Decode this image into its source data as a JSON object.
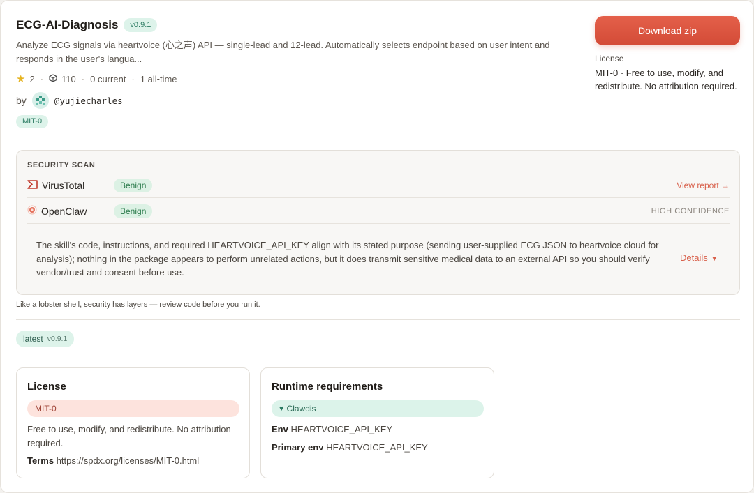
{
  "skill": {
    "title": "ECG-AI-Diagnosis",
    "version": "v0.9.1",
    "description": "Analyze ECG signals via heartvoice (心之声) API — single-lead and 12-lead. Automatically selects endpoint based on user intent and responds in the user's langua...",
    "stars": "2",
    "downloads": "110",
    "current_installs": "0 current",
    "alltime_installs": "1 all-time",
    "by_label": "by",
    "author": "@yujiecharles",
    "license_tag": "MIT-0"
  },
  "sidebar": {
    "download_label": "Download zip",
    "license_label": "License",
    "license_text": "MIT-0 · Free to use, modify, and redistribute. No attribution required."
  },
  "security": {
    "title": "SECURITY SCAN",
    "virustotal": {
      "name": "VirusTotal",
      "status": "Benign",
      "action": "View report →"
    },
    "openclaw": {
      "name": "OpenClaw",
      "status": "Benign",
      "confidence": "HIGH CONFIDENCE"
    },
    "summary": "The skill's code, instructions, and required HEARTVOICE_API_KEY align with its stated purpose (sending user-supplied ECG JSON to heartvoice cloud for analysis); nothing in the package appears to perform unrelated actions, but it does transmit sensitive medical data to an external API so you should verify vendor/trust and consent before use.",
    "details_label": "Details",
    "footnote": "Like a lobster shell, security has layers — review code before you run it."
  },
  "latest": {
    "tag": "latest",
    "version": "v0.9.1"
  },
  "license_card": {
    "title": "License",
    "badge": "MIT-0",
    "text": "Free to use, modify, and redistribute. No attribution required.",
    "terms_label": "Terms",
    "terms_url": "https://spdx.org/licenses/MIT-0.html"
  },
  "runtime_card": {
    "title": "Runtime requirements",
    "badge": "Clawdis",
    "env_label": "Env",
    "env_value": "HEARTVOICE_API_KEY",
    "primary_env_label": "Primary env",
    "primary_env_value": "HEARTVOICE_API_KEY"
  },
  "colors": {
    "accent": "#d8604b",
    "benign_bg": "#dcf1e4",
    "tag_bg": "#ddf3ea"
  },
  "icons": {
    "stars": "star-icon",
    "downloads": "box-icon",
    "virustotal": "virustotal-icon",
    "openclaw": "openclaw-icon",
    "runtime": "heart-icon"
  }
}
